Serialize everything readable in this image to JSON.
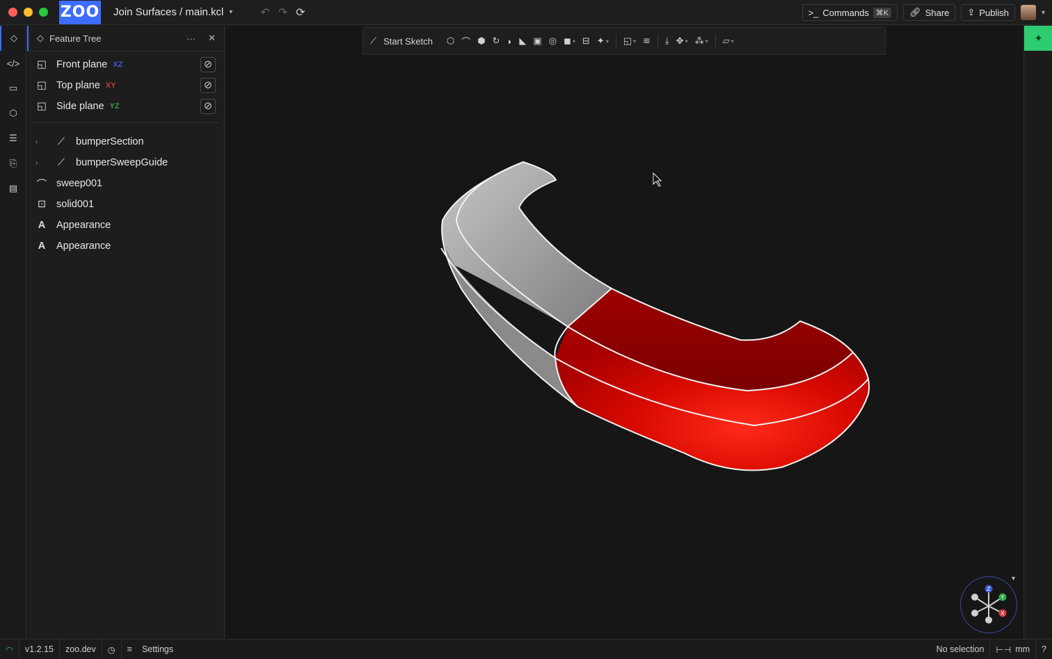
{
  "titlebar": {
    "logo": "ZOO",
    "project_title": "Join Surfaces / main.kcl",
    "commands_label": "Commands",
    "commands_shortcut": "⌘K",
    "share_label": "Share",
    "publish_label": "Publish"
  },
  "panel": {
    "title": "Feature Tree",
    "more": "···",
    "close": "✕",
    "planes": [
      {
        "label": "Front plane",
        "axis": "XZ",
        "axis_color": "#3d5bd1"
      },
      {
        "label": "Top plane",
        "axis": "XY",
        "axis_color": "#c23b3b"
      },
      {
        "label": "Side plane",
        "axis": "YZ",
        "axis_color": "#3c9a3c"
      }
    ],
    "features": [
      {
        "label": "bumperSection",
        "icon": "sketch-icon",
        "expandable": true
      },
      {
        "label": "bumperSweepGuide",
        "icon": "sketch-icon",
        "expandable": true
      },
      {
        "label": "sweep001",
        "icon": "sweep-icon",
        "expandable": false
      },
      {
        "label": "solid001",
        "icon": "solid-icon",
        "expandable": false
      },
      {
        "label": "Appearance",
        "icon": "appearance-icon",
        "expandable": false
      },
      {
        "label": "Appearance",
        "icon": "appearance-icon",
        "expandable": false
      }
    ]
  },
  "toolbar": {
    "start_sketch": "Start Sketch"
  },
  "gizmo": {
    "z": "Z",
    "y": "Y",
    "x": "X"
  },
  "statusbar": {
    "version": "v1.2.15",
    "domain": "zoo.dev",
    "settings": "Settings",
    "selection": "No selection",
    "units": "mm",
    "help": "?"
  },
  "colors": {
    "accent": "#3d6dff",
    "model_red": "#c40000",
    "model_gray": "#9a9a9a",
    "ai_button": "#2ecc71"
  }
}
